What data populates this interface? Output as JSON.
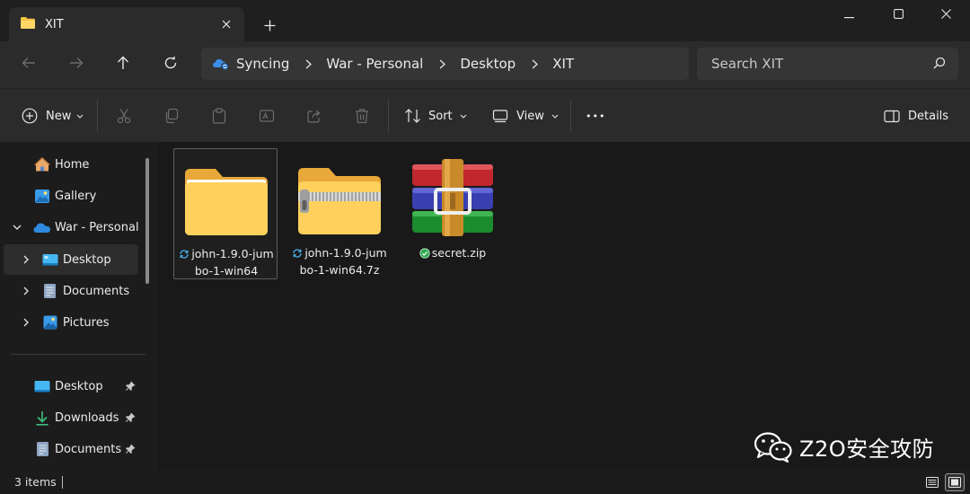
{
  "window": {
    "tab_title": "XIT",
    "new_tab_glyph": "+",
    "controls": [
      "minimize-icon",
      "maximize-icon",
      "close-icon"
    ]
  },
  "address": {
    "sync_label": "Syncing",
    "crumbs": [
      "War - Personal",
      "Desktop",
      "XIT"
    ]
  },
  "search": {
    "placeholder": "Search XIT"
  },
  "toolbar": {
    "new_label": "New",
    "sort_label": "Sort",
    "view_label": "View",
    "details_label": "Details",
    "more_glyph": "•••"
  },
  "sidebar": {
    "items": [
      {
        "label": "Home",
        "icon": "home-icon"
      },
      {
        "label": "Gallery",
        "icon": "gallery-icon"
      },
      {
        "label": "War - Personal",
        "icon": "onedrive-icon",
        "expanded": true
      },
      {
        "label": "Desktop",
        "icon": "desktop-icon",
        "selected": true
      },
      {
        "label": "Documents",
        "icon": "documents-icon"
      },
      {
        "label": "Pictures",
        "icon": "pictures-icon"
      }
    ],
    "quick_access": [
      {
        "label": "Desktop",
        "icon": "desktop-icon",
        "pinned": true
      },
      {
        "label": "Downloads",
        "icon": "downloads-icon",
        "pinned": true
      },
      {
        "label": "Documents",
        "icon": "documents-icon",
        "pinned": true
      }
    ]
  },
  "files": [
    {
      "name_line1": "john-1.9.0-jum",
      "name_line2": "bo-1-win64",
      "type": "folder",
      "status": "syncing-icon"
    },
    {
      "name_line1": "john-1.9.0-jum",
      "name_line2": "bo-1-win64.7z",
      "type": "zipped-folder",
      "status": "syncing-icon"
    },
    {
      "name_line1": "secret.zip",
      "name_line2": "",
      "type": "rar-archive",
      "status": "synced-check-icon"
    }
  ],
  "watermark": {
    "text": "Z2O安全攻防"
  },
  "status": {
    "count": "3 items"
  },
  "colors": {
    "accent": "#4cc2ff",
    "folder": "#f6c343",
    "background": "#191919"
  }
}
